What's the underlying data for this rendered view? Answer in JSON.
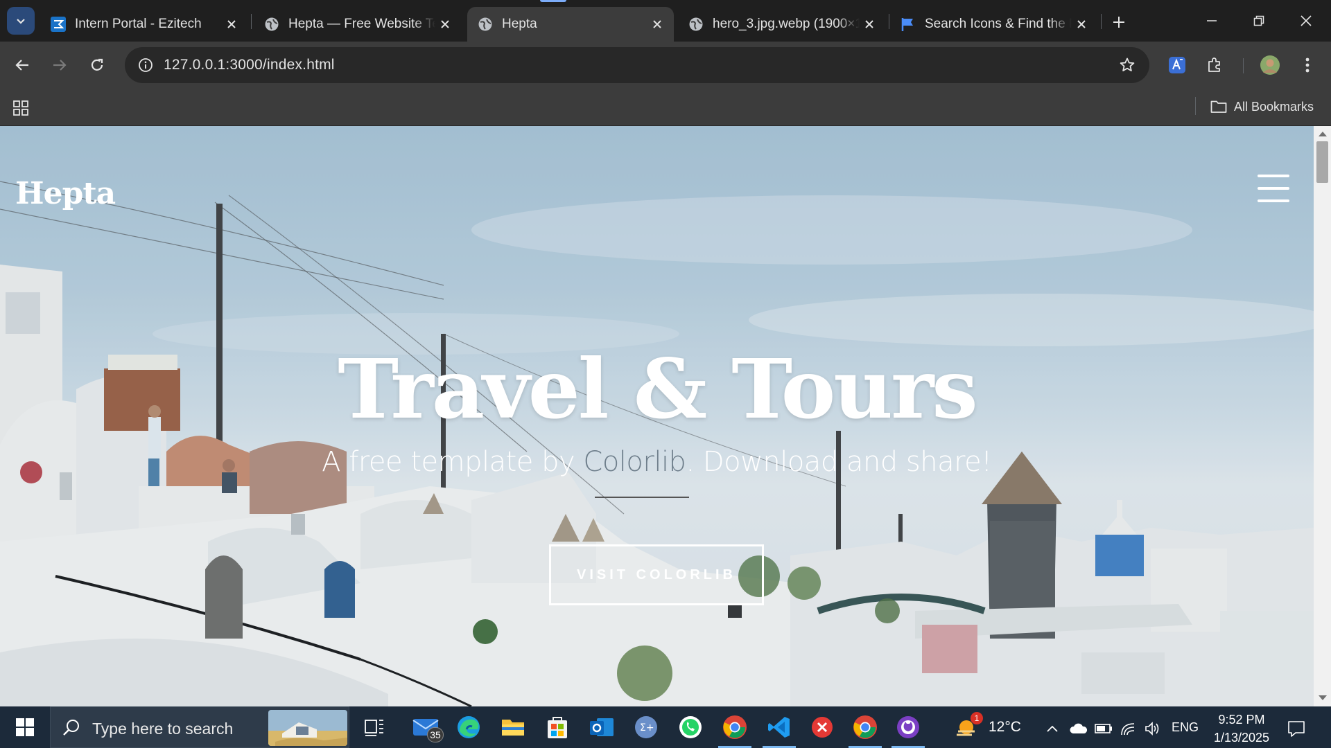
{
  "browser": {
    "tabs": [
      {
        "title": "Intern Portal - Ezitech",
        "icon": "ezitech-favicon",
        "active": false
      },
      {
        "title": "Hepta — Free Website Te",
        "icon": "globe-icon",
        "active": false
      },
      {
        "title": "Hepta",
        "icon": "globe-icon",
        "active": true
      },
      {
        "title": "hero_3.jpg.webp (1900×1",
        "icon": "globe-icon",
        "active": false
      },
      {
        "title": "Search Icons & Find the P",
        "icon": "flag-favicon",
        "active": false
      }
    ],
    "url": "127.0.0.1:3000/index.html",
    "bookmarks_label": "All Bookmarks"
  },
  "page": {
    "brand": "Hepta",
    "hero_title": "Travel & Tours",
    "hero_sub_prefix": "A free template by ",
    "hero_sub_link": "Colorlib",
    "hero_sub_suffix": ". Download and share!",
    "cta_label": "VISIT COLORLIB"
  },
  "taskbar": {
    "search_placeholder": "Type here to search",
    "mail_badge": "35",
    "weather_badge": "1",
    "temperature": "12°C",
    "language": "ENG",
    "time": "9:52 PM",
    "date": "1/13/2025"
  },
  "colors": {
    "accent": "#7cacf8",
    "hero_link": "#6f7f8c",
    "taskbar": "#1c2a3a"
  }
}
